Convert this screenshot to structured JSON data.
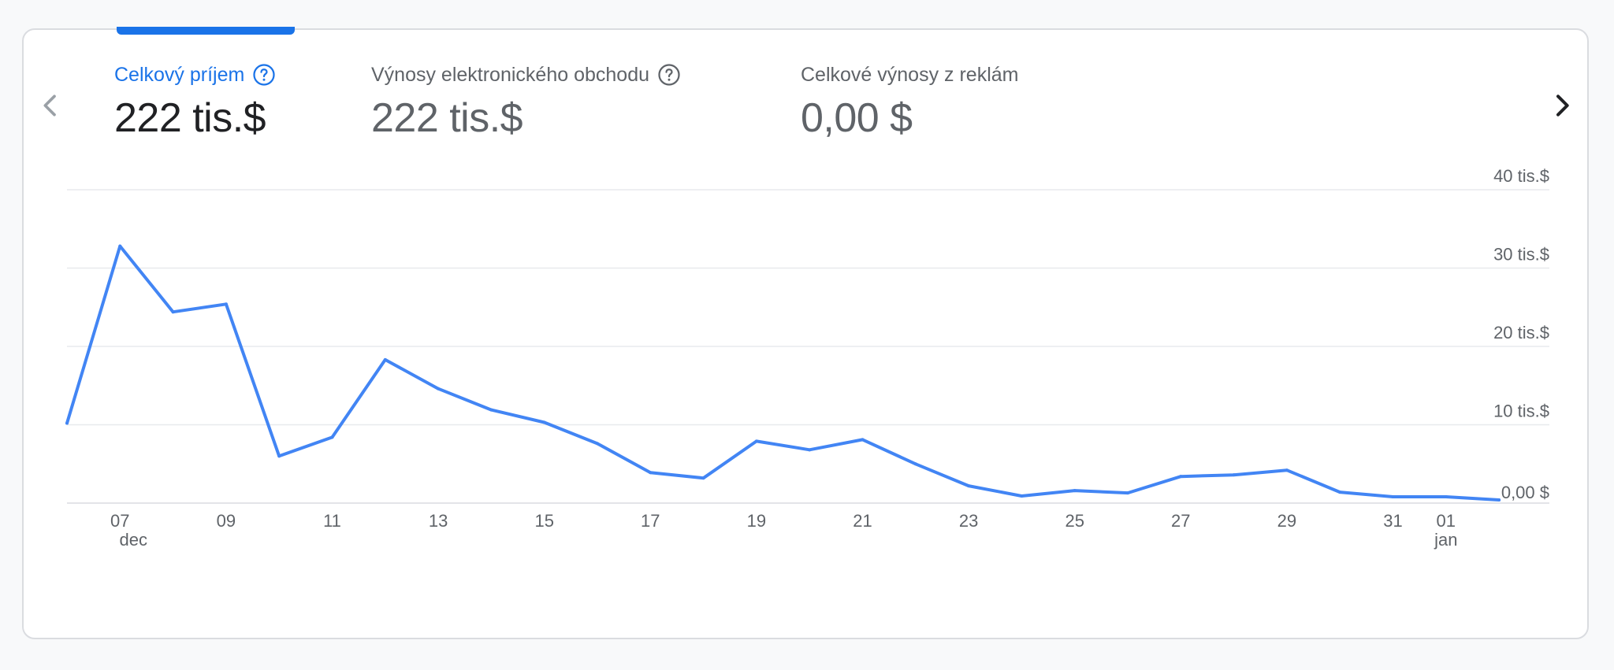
{
  "tabs": [
    {
      "label": "Celkový príjem",
      "value": "222 tis.$",
      "active": true,
      "has_help": true
    },
    {
      "label": "Výnosy elektronického obchodu",
      "value": "222 tis.$",
      "active": false,
      "has_help": true
    },
    {
      "label": "Celkové výnosy z reklám",
      "value": "0,00 $",
      "active": false,
      "has_help": false
    }
  ],
  "icons": {
    "prev": "chevron-left-icon",
    "next": "chevron-right-icon",
    "help": "help-circle-icon"
  },
  "colors": {
    "accent": "#1a73e8",
    "line": "#4285f4",
    "grid": "#e8eaed",
    "text": "#5f6368"
  },
  "chart_data": {
    "type": "line",
    "x": [
      "2023-12-06",
      "2023-12-07",
      "2023-12-08",
      "2023-12-09",
      "2023-12-10",
      "2023-12-11",
      "2023-12-12",
      "2023-12-13",
      "2023-12-14",
      "2023-12-15",
      "2023-12-16",
      "2023-12-17",
      "2023-12-18",
      "2023-12-19",
      "2023-12-20",
      "2023-12-21",
      "2023-12-22",
      "2023-12-23",
      "2023-12-24",
      "2023-12-25",
      "2023-12-26",
      "2023-12-27",
      "2023-12-28",
      "2023-12-29",
      "2023-12-30",
      "2023-12-31",
      "2024-01-01",
      "2024-01-02"
    ],
    "series": [
      {
        "values": [
          10200,
          32800,
          24400,
          25400,
          6000,
          8400,
          18300,
          14600,
          11900,
          10300,
          7600,
          3900,
          3200,
          7900,
          6800,
          8100,
          5000,
          2200,
          900,
          1600,
          1300,
          3400,
          3600,
          4200,
          1400,
          800,
          800,
          400
        ]
      }
    ],
    "x_tick_labels": [
      {
        "day": "07",
        "month": "dec"
      },
      {
        "day": "09"
      },
      {
        "day": "11"
      },
      {
        "day": "13"
      },
      {
        "day": "15"
      },
      {
        "day": "17"
      },
      {
        "day": "19"
      },
      {
        "day": "21"
      },
      {
        "day": "23"
      },
      {
        "day": "25"
      },
      {
        "day": "27"
      },
      {
        "day": "29"
      },
      {
        "day": "31"
      },
      {
        "day": "01",
        "month": "jan"
      }
    ],
    "y_tick_labels": [
      "0,00 $",
      "10 tis.$",
      "20 tis.$",
      "30 tis.$",
      "40 tis.$"
    ],
    "ylim": [
      0,
      40000
    ],
    "y_axis_side": "right",
    "grid": true,
    "legend": "none"
  }
}
